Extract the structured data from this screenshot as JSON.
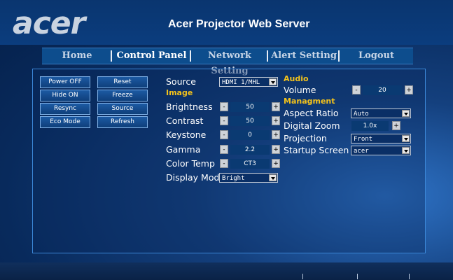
{
  "header": {
    "logo": "acer",
    "title": "Acer Projector Web Server"
  },
  "nav": {
    "tabs": [
      "Home",
      "Control Panel",
      "Network Setting",
      "Alert Setting",
      "Logout"
    ],
    "active": "Control Panel"
  },
  "buttons": {
    "power_off": "Power OFF",
    "reset": "Reset",
    "hide_on": "Hide ON",
    "freeze": "Freeze",
    "resync": "Resync",
    "source": "Source",
    "eco_mode": "Eco Mode",
    "refresh": "Refresh"
  },
  "image": {
    "source_label": "Source",
    "source_value": "HDMI 1/MHL",
    "section": "Image",
    "brightness_label": "Brightness",
    "brightness_value": "50",
    "contrast_label": "Contrast",
    "contrast_value": "50",
    "keystone_label": "Keystone",
    "keystone_value": "0",
    "gamma_label": "Gamma",
    "gamma_value": "2.2",
    "color_temp_label": "Color Temp",
    "color_temp_value": "CT3",
    "display_mode_label": "Display Mode",
    "display_mode_value": "Bright"
  },
  "audio": {
    "section": "Audio",
    "volume_label": "Volume",
    "volume_value": "20"
  },
  "management": {
    "section": "Managment",
    "aspect_ratio_label": "Aspect Ratio",
    "aspect_ratio_value": "Auto",
    "digital_zoom_label": "Digital Zoom",
    "digital_zoom_value": "1.0x",
    "projection_label": "Projection",
    "projection_value": "Front",
    "startup_screen_label": "Startup Screen",
    "startup_screen_value": "acer"
  },
  "controls": {
    "minus": "-",
    "plus": "+"
  }
}
